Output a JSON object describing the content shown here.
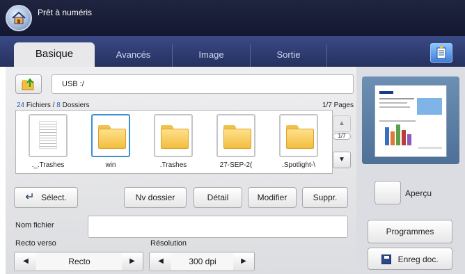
{
  "app": {
    "title": "Prêt à numéris"
  },
  "tabs": [
    {
      "label": "Basique"
    },
    {
      "label": "Avancés"
    },
    {
      "label": "Image"
    },
    {
      "label": "Sortie"
    }
  ],
  "path": {
    "value": "USB :/"
  },
  "browser": {
    "files_count": "24",
    "files_label": "Fichiers /",
    "folders_count": "8",
    "folders_label": "Dossiers",
    "pages": "1/7 Pages",
    "scroll_page": "1/7",
    "items": [
      {
        "name": "._.Trashes",
        "type": "document"
      },
      {
        "name": "win",
        "type": "folder"
      },
      {
        "name": ".Trashes",
        "type": "folder"
      },
      {
        "name": "27-SEP-2(",
        "type": "folder"
      },
      {
        "name": ".Spotlight-\\",
        "type": "folder"
      }
    ]
  },
  "actions": {
    "select": "Sélect.",
    "new_folder": "Nv dossier",
    "detail": "Détail",
    "modify": "Modifier",
    "delete": "Suppr."
  },
  "filename": {
    "label": "Nom fichier",
    "value": ""
  },
  "duplex": {
    "label": "Recto verso",
    "value": "Recto"
  },
  "resolution": {
    "label": "Résolution",
    "value": "300 dpi"
  },
  "side": {
    "preview": "Aperçu",
    "programs": "Programmes",
    "save_doc": "Enreg doc."
  }
}
